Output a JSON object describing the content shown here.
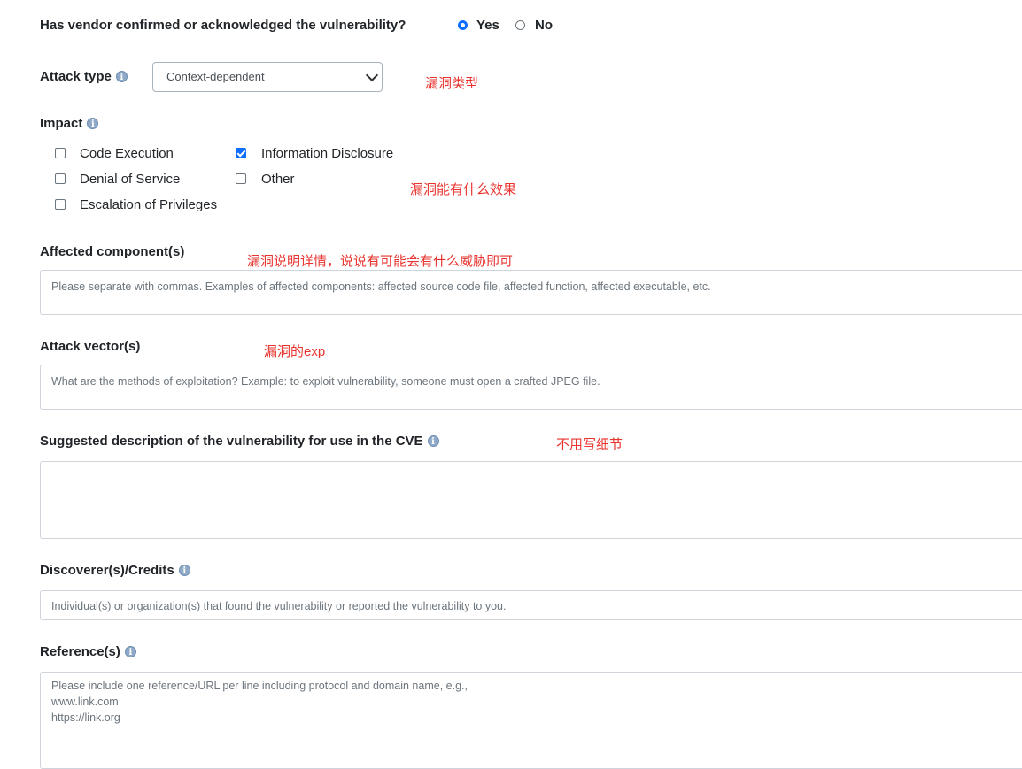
{
  "vendor": {
    "question": "Has vendor confirmed or acknowledged the vulnerability?",
    "options": [
      {
        "label": "Yes",
        "selected": true
      },
      {
        "label": "No",
        "selected": false
      }
    ]
  },
  "attack_type": {
    "label": "Attack type",
    "selected": "Context-dependent",
    "info_icon": "info-icon",
    "note": "漏洞类型"
  },
  "impact": {
    "label": "Impact",
    "info_icon": "info-icon",
    "options": [
      {
        "label": "Code Execution",
        "checked": false
      },
      {
        "label": "Information Disclosure",
        "checked": true
      },
      {
        "label": "Denial of Service",
        "checked": false
      },
      {
        "label": "Other",
        "checked": false
      },
      {
        "label": "Escalation of Privileges",
        "checked": false
      }
    ],
    "note": "漏洞能有什么效果"
  },
  "affected_components": {
    "label": "Affected component(s)",
    "placeholder": "Please separate with commas. Examples of affected components: affected source code file, affected function, affected executable, etc.",
    "value": "",
    "note": "漏洞说明详情，说说有可能会有什么威胁即可"
  },
  "attack_vectors": {
    "label": "Attack vector(s)",
    "placeholder": "What are the methods of exploitation? Example: to exploit vulnerability, someone must open a crafted JPEG file.",
    "value": "",
    "note": "漏洞的exp"
  },
  "description": {
    "label": "Suggested description of the vulnerability for use in the CVE",
    "placeholder": "",
    "value": "",
    "note": "不用写细节"
  },
  "discoverers": {
    "label": "Discoverer(s)/Credits",
    "placeholder": "Individual(s) or organization(s) that found the vulnerability or reported the vulnerability to you.",
    "value": ""
  },
  "references": {
    "label": "Reference(s)",
    "placeholder": "Please include one reference/URL per line including protocol and domain name, e.g.,\nwww.link.com\nhttps://link.org",
    "value": ""
  },
  "colors": {
    "accent": "#0d6efd",
    "annotation": "#e8332e",
    "info_icon": "#8fa9c6"
  }
}
